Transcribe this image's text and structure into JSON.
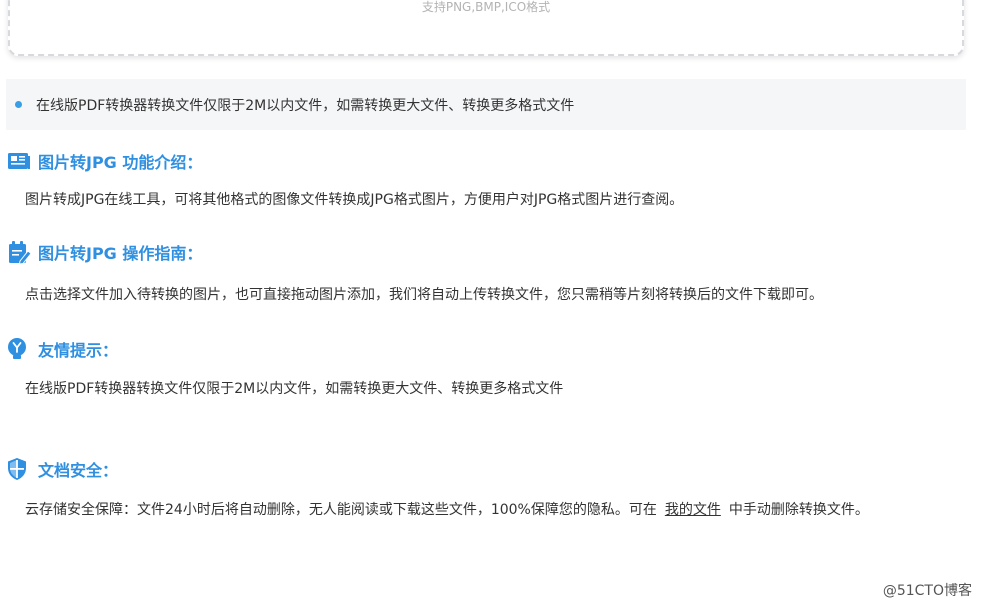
{
  "upload": {
    "hint": "支持PNG,BMP,ICO格式"
  },
  "notice": {
    "text": "在线版PDF转换器转换文件仅限于2M以内文件，如需转换更大文件、转换更多格式文件"
  },
  "sections": [
    {
      "title": "图片转JPG 功能介绍：",
      "icon": "intro-icon",
      "text": "图片转成JPG在线工具，可将其他格式的图像文件转换成JPG格式图片，方便用户对JPG格式图片进行查阅。"
    },
    {
      "title": "图片转JPG 操作指南：",
      "icon": "guide-icon",
      "text": "点击选择文件加入待转换的图片，也可直接拖动图片添加，我们将自动上传转换文件，您只需稍等片刻将转换后的文件下载即可。"
    },
    {
      "title": "友情提示：",
      "icon": "lightbulb-icon",
      "text": "在线版PDF转换器转换文件仅限于2M以内文件，如需转换更大文件、转换更多格式文件"
    },
    {
      "title": "文档安全：",
      "icon": "shield-icon",
      "text_before": "云存储安全保障：文件24小时后将自动删除，无人能阅读或下载这些文件，100%保障您的隐私。可在",
      "link": "我的文件",
      "text_after": "中手动删除转换文件。"
    }
  ],
  "watermark": "@51CTO博客",
  "colors": {
    "accent": "#2f8fe0",
    "notice_bg": "#f5f6f8",
    "text": "#333333"
  }
}
